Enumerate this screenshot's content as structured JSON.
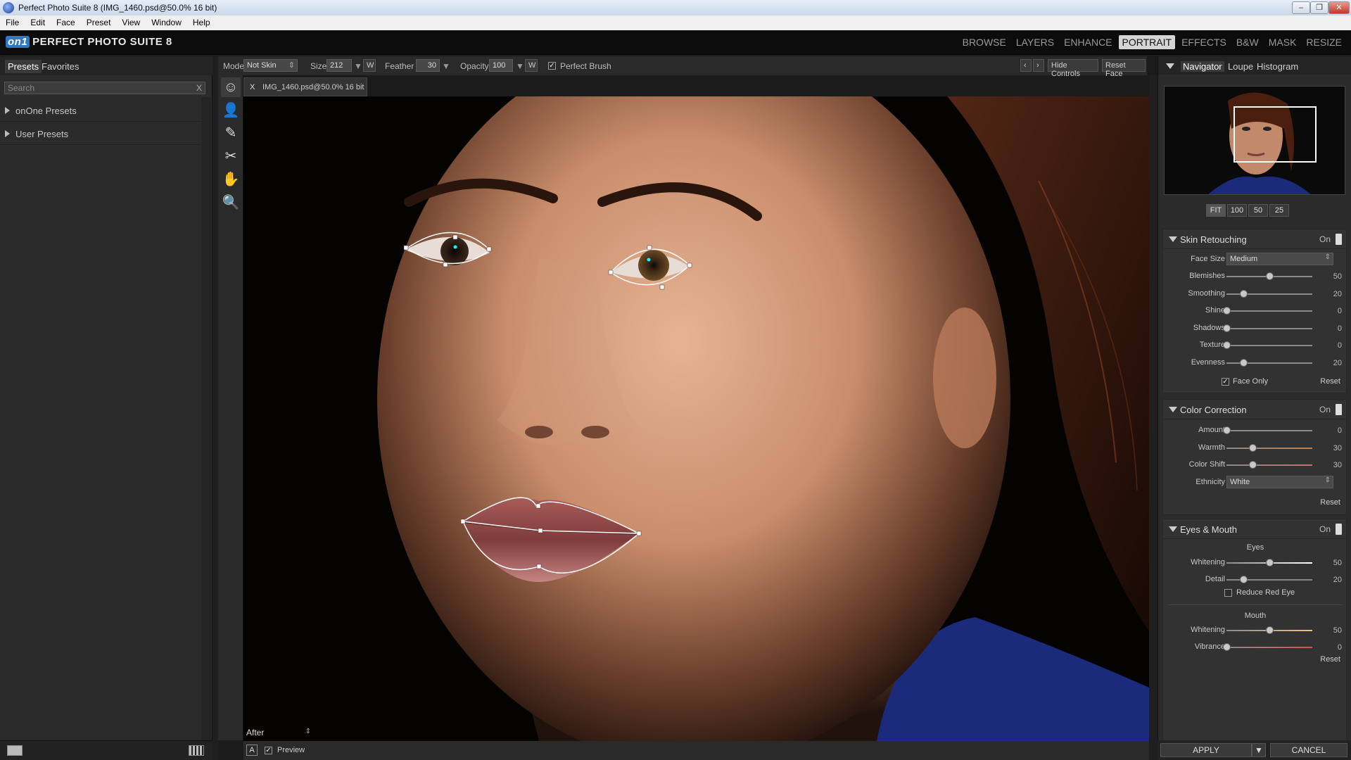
{
  "window": {
    "title": "Perfect Photo Suite 8 (IMG_1460.psd@50.0% 16 bit)"
  },
  "menu": [
    "File",
    "Edit",
    "Face",
    "Preset",
    "View",
    "Window",
    "Help"
  ],
  "app": {
    "logo_mark": "on1",
    "logo_text": "PERFECT PHOTO SUITE 8"
  },
  "modules": {
    "items": [
      "BROWSE",
      "LAYERS",
      "ENHANCE",
      "PORTRAIT",
      "EFFECTS",
      "B&W",
      "MASK",
      "RESIZE"
    ],
    "active": "PORTRAIT"
  },
  "left_panel": {
    "tabs": [
      "Presets",
      "Favorites"
    ],
    "search_placeholder": "Search",
    "search_clear": "X",
    "groups": [
      "onOne Presets",
      "User Presets"
    ]
  },
  "options_bar": {
    "mode_label": "Mode",
    "mode_value": "Not Skin",
    "size_label": "Size",
    "size_value": "212",
    "size_w": "W",
    "feather_label": "Feather",
    "feather_value": "30",
    "opacity_label": "Opacity",
    "opacity_value": "100",
    "opacity_w": "W",
    "perfect_brush_label": "Perfect Brush",
    "hide_controls": "Hide Controls",
    "reset_face": "Reset Face"
  },
  "document_tab": {
    "close": "X",
    "name": "IMG_1460.psd@50.0% 16 bit"
  },
  "view_bar": {
    "view": "After",
    "preview_label": "Preview"
  },
  "navigator": {
    "tabs": [
      "Navigator",
      "Loupe",
      "Histogram"
    ],
    "zoom_buttons": [
      "FIT",
      "100",
      "50",
      "25"
    ]
  },
  "skin_retouching": {
    "title": "Skin Retouching",
    "on": "On",
    "face_size_label": "Face Size",
    "face_size_value": "Medium",
    "sliders": [
      {
        "label": "Blemishes",
        "value": 50
      },
      {
        "label": "Smoothing",
        "value": 20
      },
      {
        "label": "Shine",
        "value": 0
      },
      {
        "label": "Shadows",
        "value": 0
      },
      {
        "label": "Texture",
        "value": 0
      },
      {
        "label": "Evenness",
        "value": 20
      }
    ],
    "face_only_label": "Face Only",
    "reset": "Reset"
  },
  "color_correction": {
    "title": "Color Correction",
    "on": "On",
    "sliders": [
      {
        "label": "Amount",
        "value": 0
      },
      {
        "label": "Warmth",
        "value": 30
      },
      {
        "label": "Color Shift",
        "value": 30
      }
    ],
    "ethnicity_label": "Ethnicity",
    "ethnicity_value": "White",
    "reset": "Reset"
  },
  "eyes_mouth": {
    "title": "Eyes & Mouth",
    "on": "On",
    "eyes_label": "Eyes",
    "eyes_sliders": [
      {
        "label": "Whitening",
        "value": 50
      },
      {
        "label": "Detail",
        "value": 20
      }
    ],
    "reduce_red_eye_label": "Reduce Red Eye",
    "mouth_label": "Mouth",
    "mouth_sliders": [
      {
        "label": "Whitening",
        "value": 50
      },
      {
        "label": "Vibrance",
        "value": 0
      }
    ],
    "reset": "Reset"
  },
  "actions": {
    "apply": "APPLY",
    "cancel": "CANCEL"
  }
}
